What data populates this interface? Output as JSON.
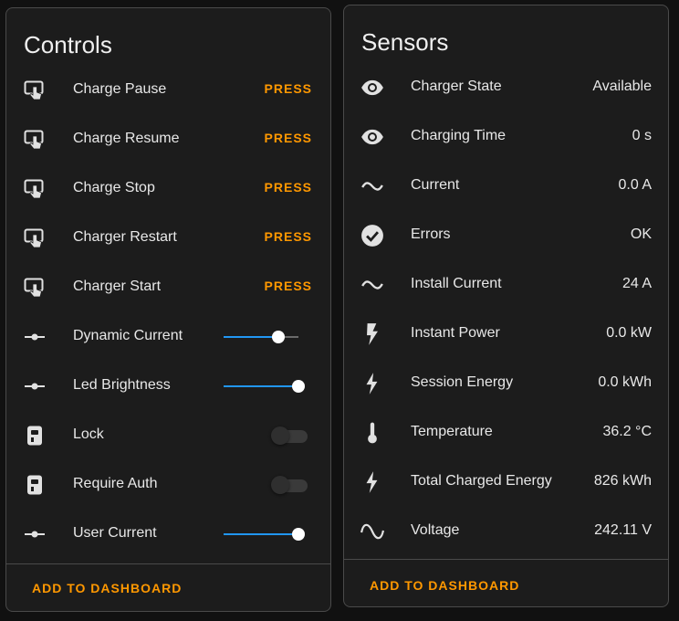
{
  "controls": {
    "title": "Controls",
    "items": [
      {
        "label": "Charge Pause",
        "action": "PRESS",
        "icon": "gesture-tap-button-icon"
      },
      {
        "label": "Charge Resume",
        "action": "PRESS",
        "icon": "gesture-tap-button-icon"
      },
      {
        "label": "Charge Stop",
        "action": "PRESS",
        "icon": "gesture-tap-button-icon"
      },
      {
        "label": "Charger Restart",
        "action": "PRESS",
        "icon": "gesture-tap-button-icon"
      },
      {
        "label": "Charger Start",
        "action": "PRESS",
        "icon": "gesture-tap-button-icon"
      },
      {
        "label": "Dynamic Current",
        "icon": "ray-vertex-icon",
        "slider_fraction": 0.73
      },
      {
        "label": "Led Brightness",
        "icon": "ray-vertex-icon",
        "slider_fraction": 1.0
      },
      {
        "label": "Lock",
        "icon": "ev-plug-icon",
        "toggle_on": false
      },
      {
        "label": "Require Auth",
        "icon": "ev-plug-icon",
        "toggle_on": false
      },
      {
        "label": "User Current",
        "icon": "ray-vertex-icon",
        "slider_fraction": 1.0
      }
    ],
    "footer": "ADD TO DASHBOARD"
  },
  "sensors": {
    "title": "Sensors",
    "items": [
      {
        "label": "Charger State",
        "value": "Available",
        "icon": "eye-icon"
      },
      {
        "label": "Charging Time",
        "value": "0 s",
        "icon": "eye-icon"
      },
      {
        "label": "Current",
        "value": "0.0 A",
        "icon": "current-ac-icon"
      },
      {
        "label": "Errors",
        "value": "OK",
        "icon": "check-circle-icon"
      },
      {
        "label": "Install Current",
        "value": "24 A",
        "icon": "current-ac-icon"
      },
      {
        "label": "Instant Power",
        "value": "0.0 kW",
        "icon": "flash-icon"
      },
      {
        "label": "Session Energy",
        "value": "0.0 kWh",
        "icon": "lightning-bolt-icon"
      },
      {
        "label": "Temperature",
        "value": "36.2 °C",
        "icon": "thermometer-icon"
      },
      {
        "label": "Total Charged Energy",
        "value": "826 kWh",
        "icon": "lightning-bolt-icon"
      },
      {
        "label": "Voltage",
        "value": "242.11 V",
        "icon": "sine-wave-icon"
      }
    ],
    "footer": "ADD TO DASHBOARD"
  },
  "colors": {
    "accent": "#ff9800",
    "slider_active": "#2196f3",
    "card_bg": "#1c1c1c",
    "page_bg": "#111111"
  }
}
